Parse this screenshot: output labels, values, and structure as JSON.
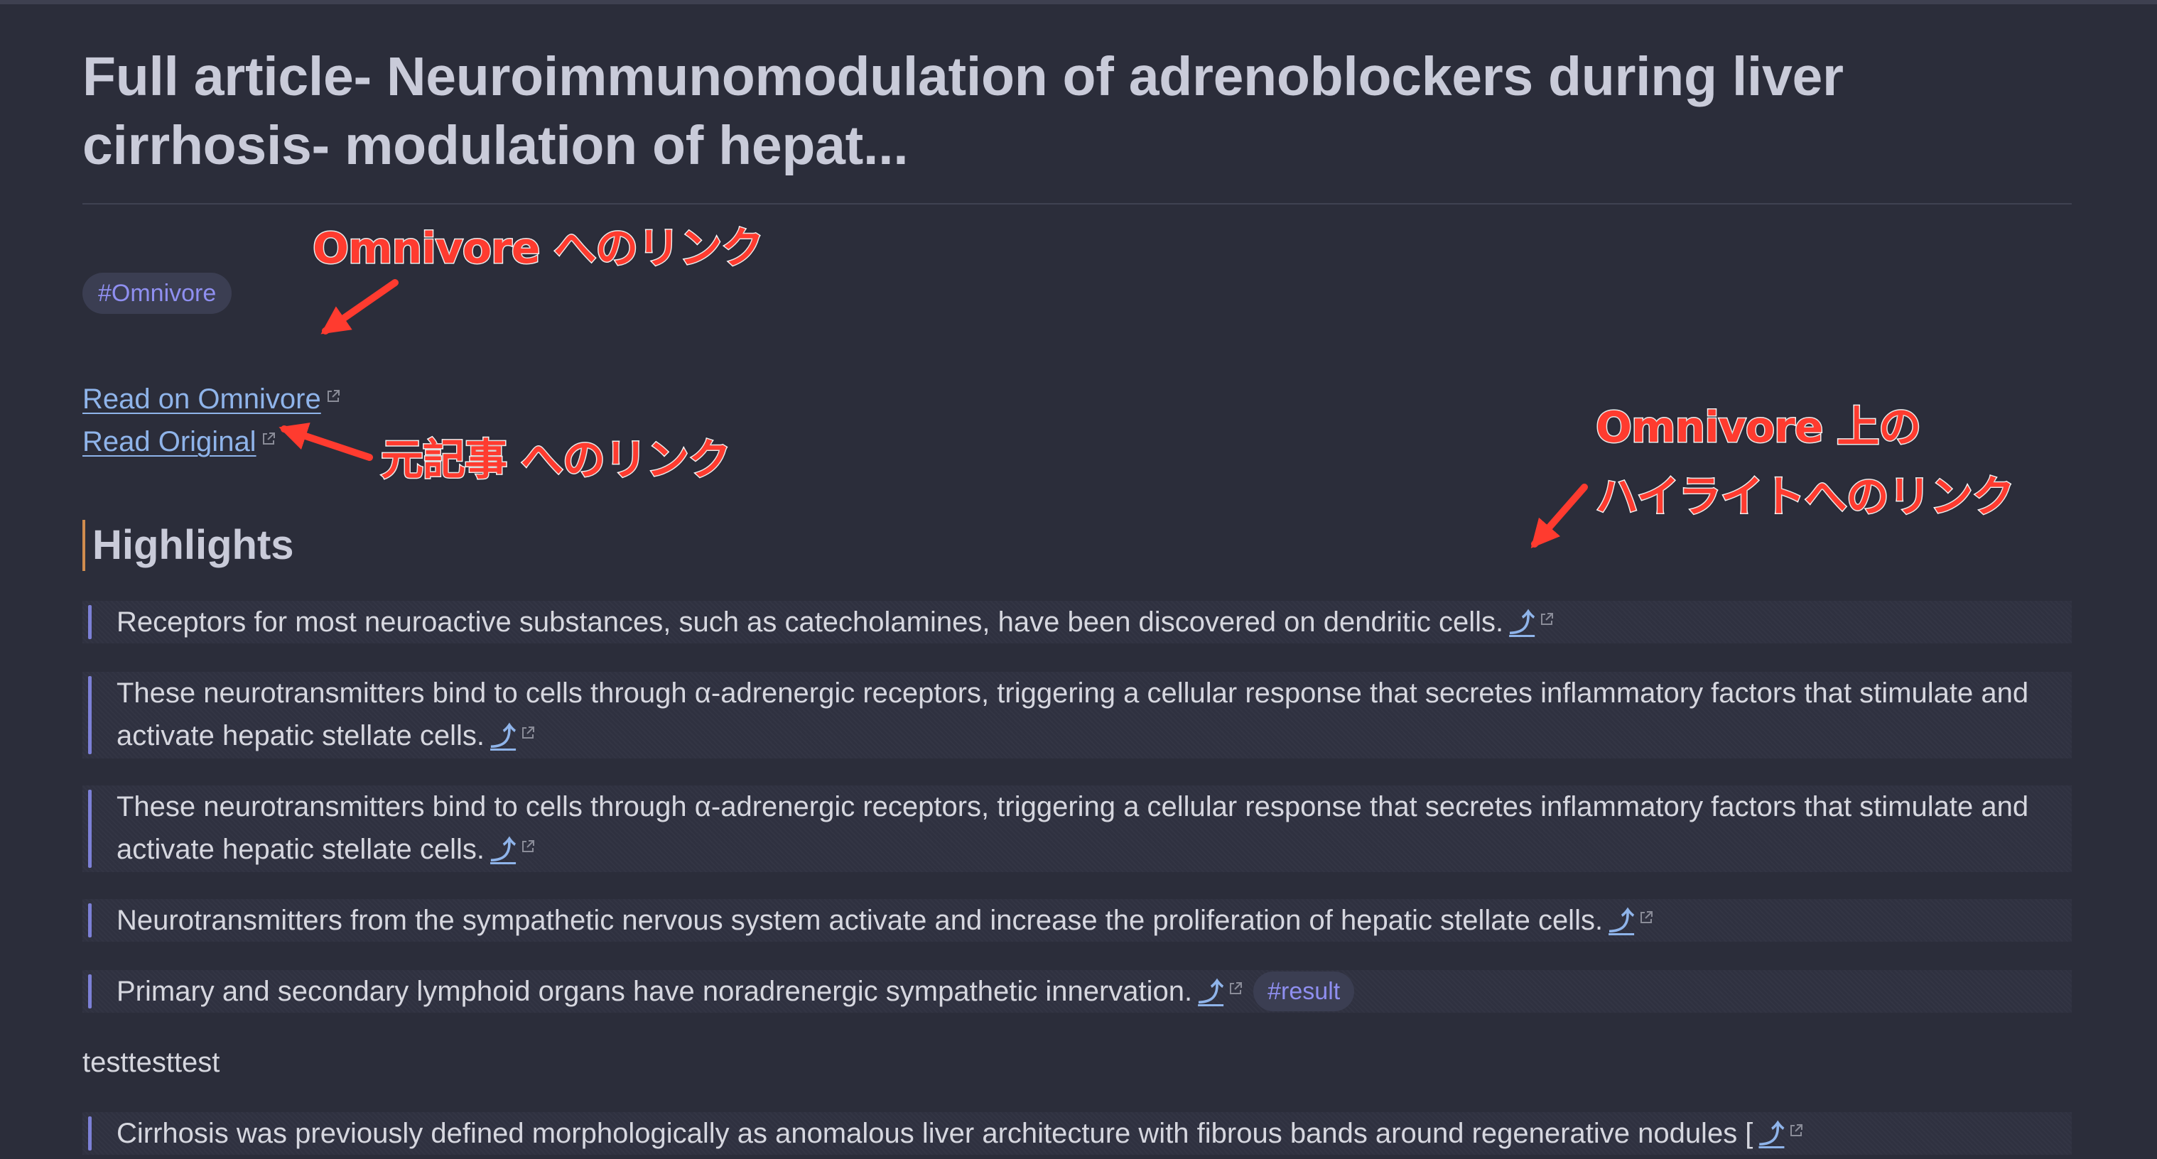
{
  "article": {
    "title": "Full article- Neuroimmunomodulation of adrenoblockers during liver cirrhosis- modulation of hepat...",
    "tag": "#Omnivore",
    "links": {
      "read_on_omnivore": "Read on Omnivore",
      "read_original": "Read Original"
    },
    "highlights_heading": "Highlights",
    "highlights": [
      {
        "text": "Receptors for most neuroactive substances, such as catecholamines, have been discovered on dendritic cells.",
        "link": "⤴"
      },
      {
        "text": "These neurotransmitters bind to cells through α-adrenergic receptors, triggering a cellular response that secretes inflammatory factors that stimulate and activate hepatic stellate cells.",
        "link": "⤴"
      },
      {
        "text": "These neurotransmitters bind to cells through α-adrenergic receptors, triggering a cellular response that secretes inflammatory factors that stimulate and activate hepatic stellate cells.",
        "link": "⤴"
      },
      {
        "text": "Neurotransmitters from the sympathetic nervous system activate and increase the proliferation of hepatic stellate cells.",
        "link": "⤴"
      },
      {
        "text": "Primary and secondary lymphoid organs have noradrenergic sympathetic innervation.",
        "link": "⤴",
        "tag": "#result"
      },
      {
        "text": "Cirrhosis was previously defined morphologically as anomalous liver architecture with fibrous bands around regenerative nodules [",
        "link": "⤴"
      }
    ],
    "note": "testtesttest"
  },
  "annotations": {
    "omnivore_link": "Omnivore へのリンク",
    "original_link": "元記事 へのリンク",
    "highlight_link_line1": "Omnivore 上の",
    "highlight_link_line2": "ハイライトへのリンク"
  },
  "colors": {
    "background": "#2b2d3a",
    "link": "#8fb4ea",
    "tag_text": "#8f8ff0",
    "quote_bar": "#7c80d6",
    "annotation": "#ff3b2f",
    "heading_marker": "#d08c4e"
  },
  "icons": {
    "external_link": "external-link-icon",
    "highlight_link": "up-arrow-link-icon"
  }
}
